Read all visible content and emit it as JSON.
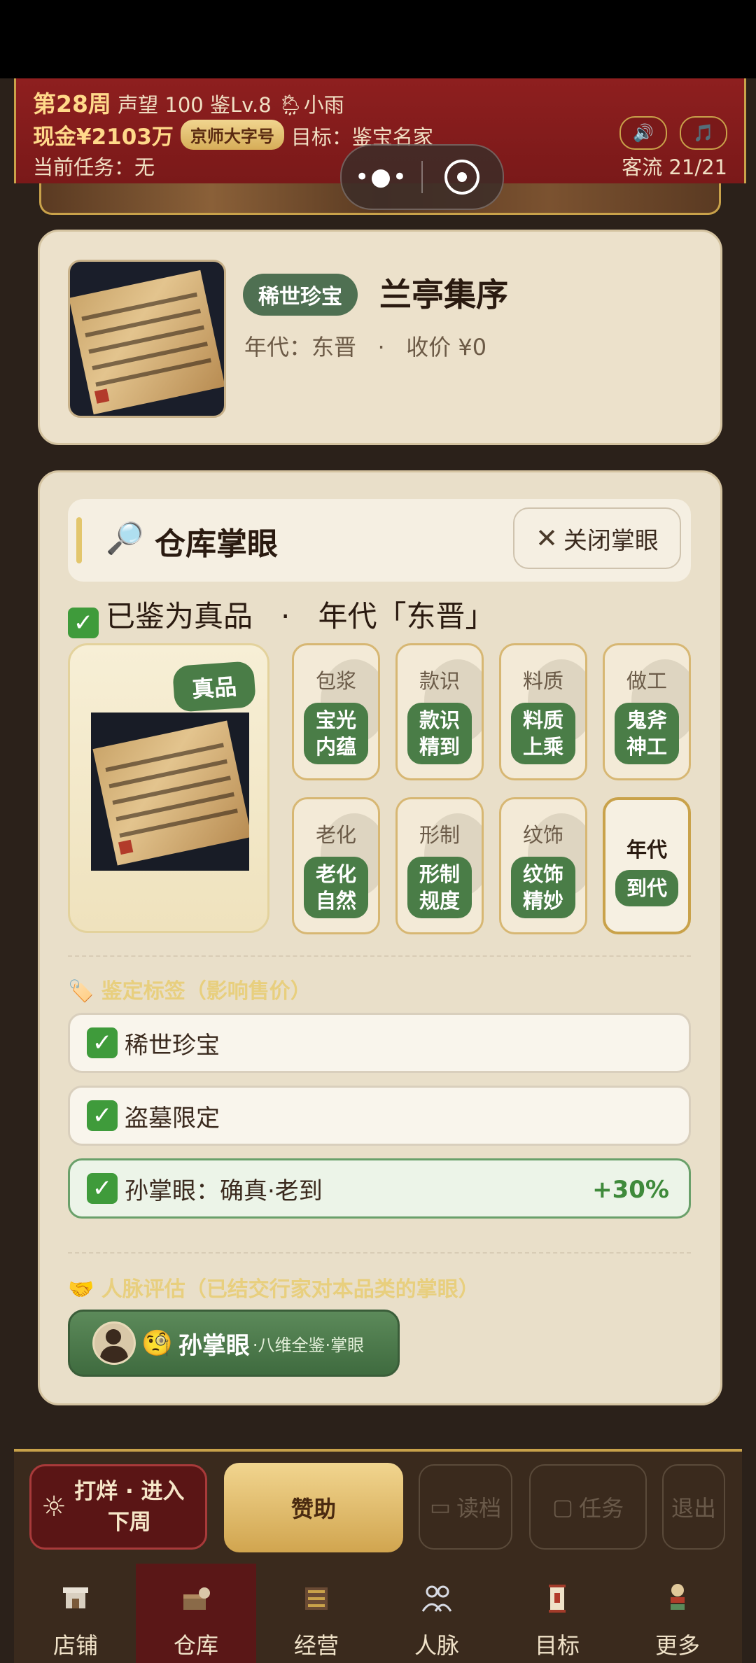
{
  "header": {
    "week": "第28周",
    "reputation": "声望 100",
    "level": "鉴Lv.8",
    "weather_icon": "rain-cloud-icon",
    "weather": "小雨",
    "cash": "现金¥2103万",
    "shop_name": "京师大字号",
    "goal": "目标：鉴宝名家",
    "task": "当前任务：无",
    "guests": "客流 21/21",
    "sound_icon": "🔊",
    "music_icon": "🎵"
  },
  "item": {
    "rarity": "稀世珍宝",
    "name": "兰亭集序",
    "meta": "年代：东晋   ·   收价 ¥0"
  },
  "panel": {
    "title": "仓库掌眼",
    "close_label": "关闭掌眼",
    "verdict": "已鉴为真品   ·   年代「东晋」",
    "genuine_badge": "真品",
    "attributes": [
      {
        "name": "包浆",
        "line1": "宝光",
        "line2": "内蕴"
      },
      {
        "name": "款识",
        "line1": "款识",
        "line2": "精到"
      },
      {
        "name": "料质",
        "line1": "料质",
        "line2": "上乘"
      },
      {
        "name": "做工",
        "line1": "鬼斧",
        "line2": "神工"
      },
      {
        "name": "老化",
        "line1": "老化",
        "line2": "自然"
      },
      {
        "name": "形制",
        "line1": "形制",
        "line2": "规度"
      },
      {
        "name": "纹饰",
        "line1": "纹饰",
        "line2": "精妙"
      },
      {
        "name": "年代",
        "line1": "到代",
        "line2": ""
      }
    ],
    "tags_title": "🏷️ 鉴定标签（影响售价）",
    "tags": [
      {
        "label": "稀世珍宝",
        "bonus": ""
      },
      {
        "label": "盗墓限定",
        "bonus": ""
      },
      {
        "label": "孙掌眼：确真·老到",
        "bonus": "+30%"
      }
    ],
    "network_title": "🤝 人脉评估（已结交行家对本品类的掌眼）",
    "expert": {
      "emoji": "🧐",
      "name": "孙掌眼",
      "sub": "·八维全鉴·掌眼"
    }
  },
  "actions": {
    "night": "打烊 · 进入下周",
    "sponsor": "赞助",
    "load": "读档",
    "task": "任务",
    "exit": "退出"
  },
  "nav": [
    {
      "label": "店铺",
      "icon": "shop-icon"
    },
    {
      "label": "仓库",
      "icon": "warehouse-icon"
    },
    {
      "label": "经营",
      "icon": "ledger-icon"
    },
    {
      "label": "人脉",
      "icon": "people-icon"
    },
    {
      "label": "目标",
      "icon": "scroll-icon"
    },
    {
      "label": "更多",
      "icon": "more-icon"
    }
  ],
  "colors": {
    "header": "#8e1f1f",
    "gold": "#c9a24a",
    "green": "#4a7d47",
    "panel": "#e9dfc9"
  }
}
